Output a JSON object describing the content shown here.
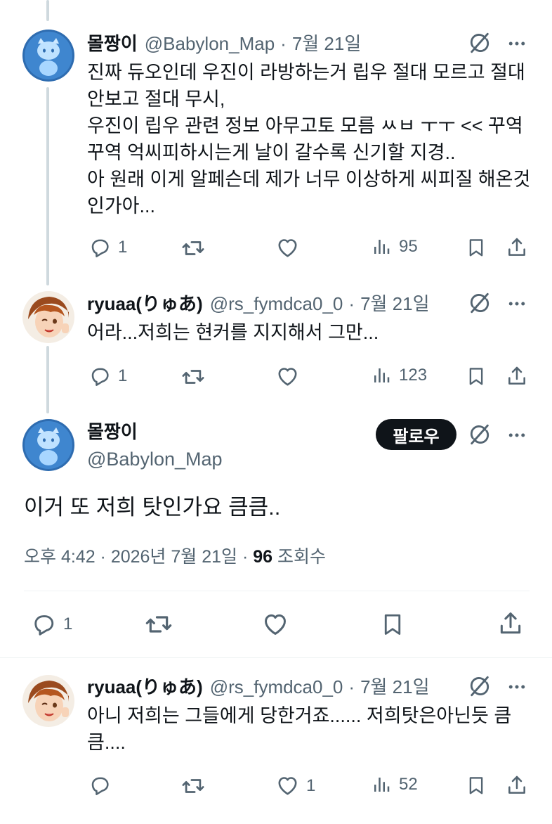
{
  "tweets": [
    {
      "name": "몰짱이",
      "handle": "@Babylon_Map",
      "dot": "·",
      "date": "7월 21일",
      "text": "진짜 듀오인데 우진이 라방하는거 립우 절대 모르고 절대\n안보고 절대 무시,\n우진이 립우 관련 정보 아무고토 모름 ㅆㅂ ㅜㅜ << 꾸역\n꾸역 억씨피하시는게 날이 갈수록 신기할 지경..\n아 원래 이게 알페슨데 제가 너무 이상하게 씨피질 해온것\n인가아...",
      "replies": "1",
      "retweets": "",
      "likes": "",
      "views": "95"
    },
    {
      "name": "ryuaa(りゅあ)",
      "handle": "@rs_fymdca0_0",
      "dot": "·",
      "date": "7월 21일",
      "text": "어라...저희는 현커를 지지해서 그만...",
      "replies": "1",
      "retweets": "",
      "likes": "",
      "views": "123"
    },
    {
      "name": "ryuaa(りゅあ)",
      "handle": "@rs_fymdca0_0",
      "dot": "·",
      "date": "7월 21일",
      "text": "아니 저희는 그들에게 당한거죠...... 저희탓은아닌듯 큼\n큼....",
      "replies": "",
      "retweets": "",
      "likes": "1",
      "views": "52"
    }
  ],
  "main_tweet": {
    "name": "몰짱이",
    "handle": "@Babylon_Map",
    "follow_label": "팔로우",
    "text": "이거 또 저희 탓인가요 큼큼..",
    "time": "오후 4:42 · 2026년 7월 21일 · ",
    "views": "96",
    "views_label": " 조회수",
    "replies": "1"
  },
  "colors": {
    "text_primary": "#0f1419",
    "text_secondary": "#536471",
    "thread_line": "#cfd9de",
    "follow_bg": "#0f1419"
  },
  "icons": [
    "reply-icon",
    "retweet-icon",
    "like-icon",
    "views-icon",
    "bookmark-icon",
    "share-icon",
    "grok-icon",
    "more-icon"
  ]
}
